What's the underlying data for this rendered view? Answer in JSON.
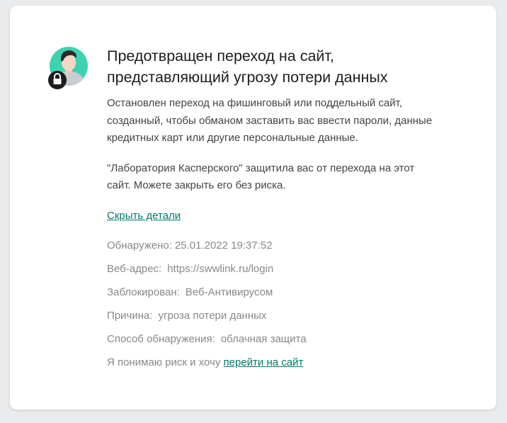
{
  "dialog": {
    "title": "Предотвращен переход на сайт,\nпредставляющий угрозу потери данных",
    "description": "Остановлен переход на фишинговый или поддельный сайт,\nсозданный, чтобы обманом заставить вас ввести пароли, данные\nкредитных карт или другие персональные данные.",
    "protection_note": "\"Лаборатория Касперского\" защитила вас от перехода на этот\nсайт. Можете закрыть его без риска.",
    "hide_details_link": "Скрыть детали",
    "icon": "user-lock-icon",
    "accent_color": "#00796b",
    "avatar_color": "#3ed3b0"
  },
  "details": {
    "detected_label": "Обнаружено:",
    "detected_value": "25.01.2022 19:37:52",
    "url_label": "Веб-адрес:",
    "url_value": "https://swwlink.ru/login",
    "blocked_by_label": "Заблокирован:",
    "blocked_by_value": "Веб-Антивирусом",
    "reason_label": "Причина:",
    "reason_value": "угроза потери данных",
    "method_label": "Способ обнаружения:",
    "method_value": "облачная защита",
    "proceed_prefix": "Я понимаю риск и хочу",
    "proceed_link": "перейти на сайт"
  }
}
